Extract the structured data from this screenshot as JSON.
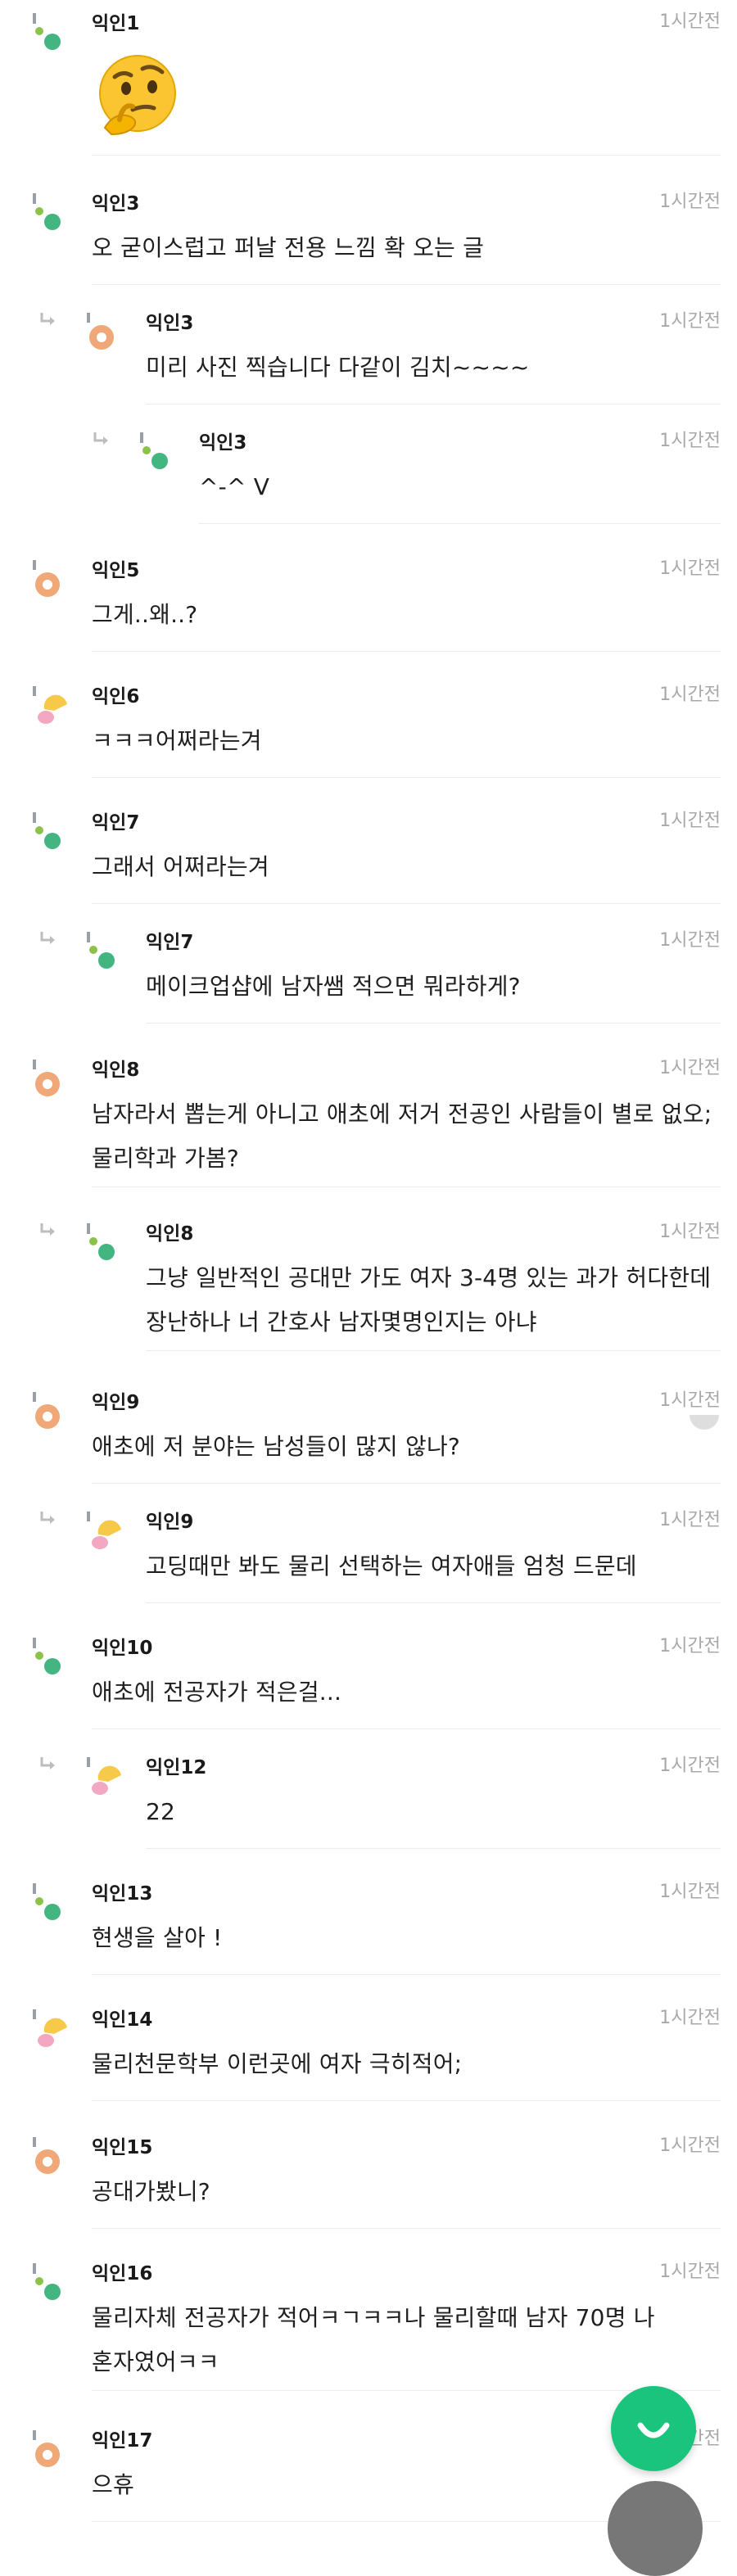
{
  "comments": [
    {
      "author": "익인1",
      "time": "1시간전",
      "text": "",
      "emoji": "thinking-face",
      "level": 0,
      "avatar": "dots-green"
    },
    {
      "author": "익인3",
      "time": "1시간전",
      "text": "오 굳이스럽고 퍼날 전용 느낌 확 오는 글",
      "level": 0,
      "avatar": "dots-green"
    },
    {
      "author": "익인3",
      "time": "1시간전",
      "text": "미리 사진 찍습니다 다같이 김치~~~~",
      "level": 1,
      "avatar": "orange-donut"
    },
    {
      "author": "익인3",
      "time": "1시간전",
      "text": "^-^ V",
      "level": 2,
      "avatar": "dots-green"
    },
    {
      "author": "익인5",
      "time": "1시간전",
      "text": "그게..왜..?",
      "level": 0,
      "avatar": "orange-donut"
    },
    {
      "author": "익인6",
      "time": "1시간전",
      "text": "ㅋㅋㅋ어쩌라는겨",
      "level": 0,
      "avatar": "yellow-pink"
    },
    {
      "author": "익인7",
      "time": "1시간전",
      "text": "그래서 어쩌라는겨",
      "level": 0,
      "avatar": "dots-green"
    },
    {
      "author": "익인7",
      "time": "1시간전",
      "text": "메이크업샵에 남자쌤 적으면 뭐라하게?",
      "level": 1,
      "avatar": "dots-green"
    },
    {
      "author": "익인8",
      "time": "1시간전",
      "text": "남자라서 뽑는게 아니고 애초에 저거 전공인 사람들이 별로 없오; 물리학과 가봄?",
      "level": 0,
      "avatar": "orange-donut"
    },
    {
      "author": "익인8",
      "time": "1시간전",
      "text": "그냥 일반적인 공대만 가도 여자 3-4명 있는 과가 허다한데 장난하나 너 간호사 남자몇명인지는 아냐",
      "level": 1,
      "avatar": "dots-green"
    },
    {
      "author": "익인9",
      "time": "1시간전",
      "text": "애초에 저 분야는 남성들이 많지 않나?",
      "level": 0,
      "avatar": "orange-donut"
    },
    {
      "author": "익인9",
      "time": "1시간전",
      "text": "고딩때만 봐도 물리 선택하는 여자애들 엄청 드문데",
      "level": 1,
      "avatar": "yellow-pink"
    },
    {
      "author": "익인10",
      "time": "1시간전",
      "text": "애초에 전공자가 적은걸...",
      "level": 0,
      "avatar": "dots-green"
    },
    {
      "author": "익인12",
      "time": "1시간전",
      "text": "22",
      "level": 1,
      "avatar": "yellow-pink"
    },
    {
      "author": "익인13",
      "time": "1시간전",
      "text": "현생을 살아 !",
      "level": 0,
      "avatar": "dots-green"
    },
    {
      "author": "익인14",
      "time": "1시간전",
      "text": "물리천문학부 이런곳에 여자 극히적어;",
      "level": 0,
      "avatar": "yellow-pink"
    },
    {
      "author": "익인15",
      "time": "1시간전",
      "text": "공대가봤니?",
      "level": 0,
      "avatar": "orange-donut"
    },
    {
      "author": "익인16",
      "time": "1시간전",
      "text": "물리자체 전공자가 적어ㅋㄱㅋㅋ나 물리할때 남자 70명 나 혼자였어ㅋㅋ",
      "level": 0,
      "avatar": "dots-green"
    },
    {
      "author": "익인17",
      "time": "1시간전",
      "text": "으휴",
      "level": 0,
      "avatar": "orange-donut"
    }
  ],
  "colors": {
    "accent_green": "#1bc47d",
    "avatar_green_light": "#8bc34a",
    "avatar_green_dark": "#43b581",
    "avatar_orange": "#f0a878",
    "avatar_yellow": "#f7c948",
    "avatar_pink": "#f2a7c3",
    "time_gray": "#a8a8a8"
  },
  "fab": {
    "icon": "smile-icon"
  }
}
